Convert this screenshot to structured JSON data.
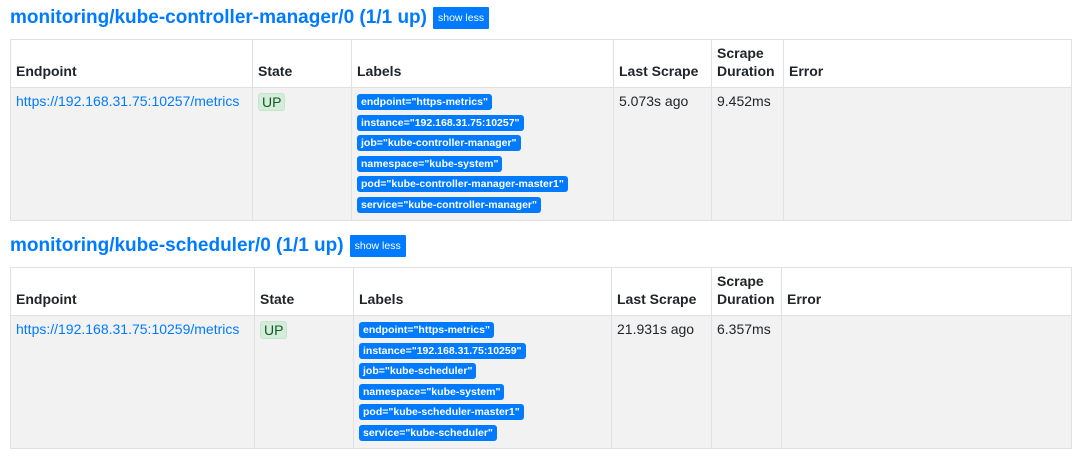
{
  "headers": {
    "endpoint": "Endpoint",
    "state": "State",
    "labels": "Labels",
    "last_scrape": "Last Scrape",
    "scrape_duration_1": "Scrape",
    "scrape_duration_2": "Duration",
    "error": "Error"
  },
  "sections": [
    {
      "title": "monitoring/kube-controller-manager/0 (1/1 up)",
      "toggle_label": "show less",
      "row": {
        "endpoint": "https://192.168.31.75:10257/metrics",
        "state": "UP",
        "labels": [
          "endpoint=\"https-metrics\"",
          "instance=\"192.168.31.75:10257\"",
          "job=\"kube-controller-manager\"",
          "namespace=\"kube-system\"",
          "pod=\"kube-controller-manager-master1\"",
          "service=\"kube-controller-manager\""
        ],
        "last_scrape": "5.073s ago",
        "scrape_duration": "9.452ms",
        "error": ""
      }
    },
    {
      "title": "monitoring/kube-scheduler/0 (1/1 up)",
      "toggle_label": "show less",
      "row": {
        "endpoint": "https://192.168.31.75:10259/metrics",
        "state": "UP",
        "labels": [
          "endpoint=\"https-metrics\"",
          "instance=\"192.168.31.75:10259\"",
          "job=\"kube-scheduler\"",
          "namespace=\"kube-system\"",
          "pod=\"kube-scheduler-master1\"",
          "service=\"kube-scheduler\""
        ],
        "last_scrape": "21.931s ago",
        "scrape_duration": "6.357ms",
        "error": ""
      }
    }
  ],
  "colors": {
    "accent": "#007bff",
    "state_up_bg": "#d4edda",
    "state_up_text": "#155724",
    "row_bg": "#f2f2f2"
  }
}
